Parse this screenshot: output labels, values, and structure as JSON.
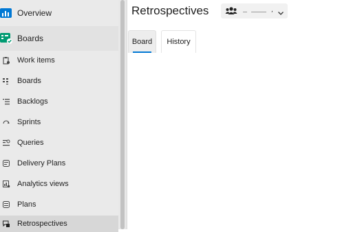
{
  "sidebar": {
    "overview_label": "Overview",
    "section_label": "Boards",
    "items": [
      {
        "label": "Work items",
        "icon": "work-items-icon"
      },
      {
        "label": "Boards",
        "icon": "boards-icon"
      },
      {
        "label": "Backlogs",
        "icon": "backlogs-icon"
      },
      {
        "label": "Sprints",
        "icon": "sprints-icon"
      },
      {
        "label": "Queries",
        "icon": "queries-icon"
      },
      {
        "label": "Delivery Plans",
        "icon": "delivery-plans-icon"
      },
      {
        "label": "Analytics views",
        "icon": "analytics-views-icon"
      },
      {
        "label": "Plans",
        "icon": "plans-icon"
      },
      {
        "label": "Retrospectives",
        "icon": "retrospectives-icon"
      }
    ],
    "active_item": "Retrospectives"
  },
  "main": {
    "title": "Retrospectives",
    "team_picker": {
      "icon": "team-icon",
      "caret": "chevron-down-icon",
      "comma": ","
    },
    "tabs": [
      {
        "label": "Board",
        "selected": true
      },
      {
        "label": "History",
        "selected": false
      }
    ]
  },
  "colors": {
    "sidebar_bg": "#eaeaea",
    "active_bg": "#d7d7d7",
    "accent": "#0078d4",
    "overview_icon": "#0078d4",
    "boards_icon_green": "#009b72"
  }
}
